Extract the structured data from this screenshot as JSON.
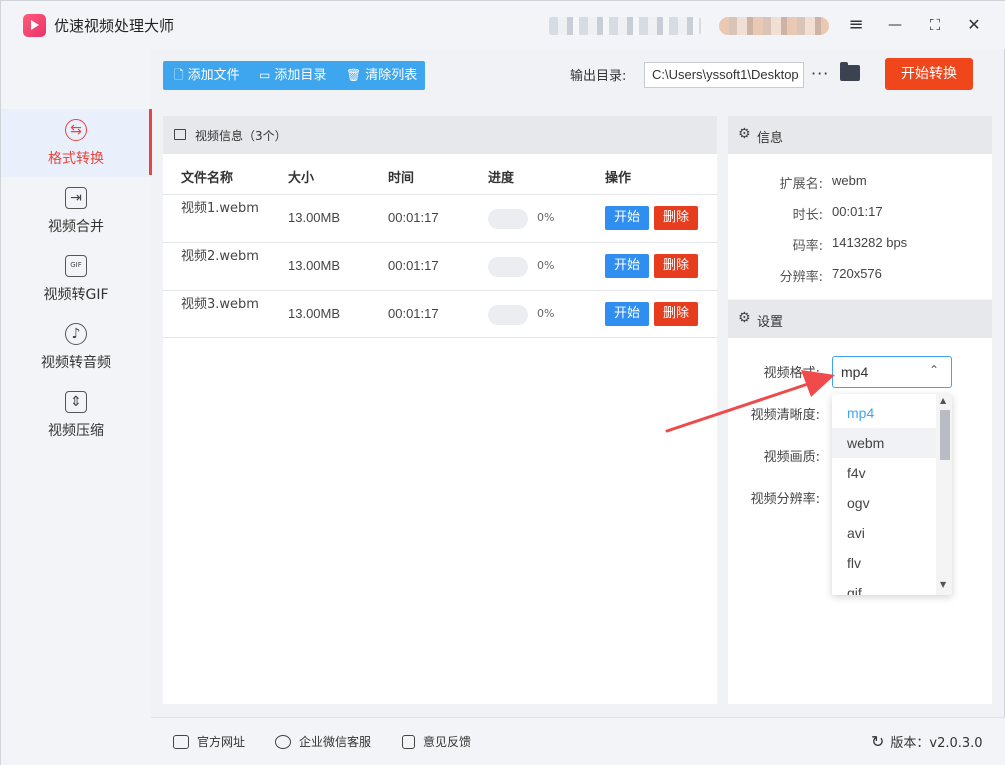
{
  "title": "优速视频处理大师",
  "window_controls": {
    "menu": "≡",
    "minimize": "—",
    "maximize": "⛶",
    "close": "✕"
  },
  "sidebar": {
    "items": [
      {
        "label": "格式转换",
        "icon": "convert-icon",
        "active": true
      },
      {
        "label": "视频合并",
        "icon": "merge-icon"
      },
      {
        "label": "视频转GIF",
        "icon": "gif-icon"
      },
      {
        "label": "视频转音频",
        "icon": "audio-icon"
      },
      {
        "label": "视频压缩",
        "icon": "compress-icon"
      }
    ]
  },
  "toolbar": {
    "add_file": "添加文件",
    "add_dir": "添加目录",
    "clear_list": "清除列表",
    "output_label": "输出目录:",
    "output_path": "C:\\Users\\yssoft1\\Desktop",
    "more": "···",
    "start_all": "开始转换"
  },
  "main": {
    "title": "视频信息（3个）",
    "columns": [
      "文件名称",
      "大小",
      "时间",
      "进度",
      "操作"
    ],
    "rows": [
      {
        "name": "视频1.webm",
        "size": "13.00MB",
        "time": "00:01:17",
        "progress": "0%",
        "progress_value": 0,
        "start": "开始",
        "delete": "删除"
      },
      {
        "name": "视频2.webm",
        "size": "13.00MB",
        "time": "00:01:17",
        "progress": "0%",
        "progress_value": 0,
        "start": "开始",
        "delete": "删除"
      },
      {
        "name": "视频3.webm",
        "size": "13.00MB",
        "time": "00:01:17",
        "progress": "0%",
        "progress_value": 0,
        "start": "开始",
        "delete": "删除"
      }
    ]
  },
  "info": {
    "title": "信息",
    "items": [
      {
        "label": "扩展名:",
        "value": "webm"
      },
      {
        "label": "时长:",
        "value": "00:01:17"
      },
      {
        "label": "码率:",
        "value": "1413282 bps"
      },
      {
        "label": "分辨率:",
        "value": "720x576"
      }
    ]
  },
  "settings": {
    "title": "设置",
    "format_label": "视频格式:",
    "clarity_label": "视频清晰度:",
    "quality_label": "视频画质:",
    "resolution_label": "视频分辨率:",
    "format_value": "mp4",
    "options": [
      "mp4",
      "webm",
      "f4v",
      "ogv",
      "avi",
      "flv",
      "gif"
    ]
  },
  "footer": {
    "website": "官方网址",
    "wechat": "企业微信客服",
    "feedback": "意见反馈",
    "version": "版本：v2.0.3.0"
  },
  "colors": {
    "accent": "#3ea6ee",
    "danger": "#e63d1e",
    "start_all": "#f0461c",
    "active": "#e8453c",
    "arrow": "#f04a4a"
  }
}
